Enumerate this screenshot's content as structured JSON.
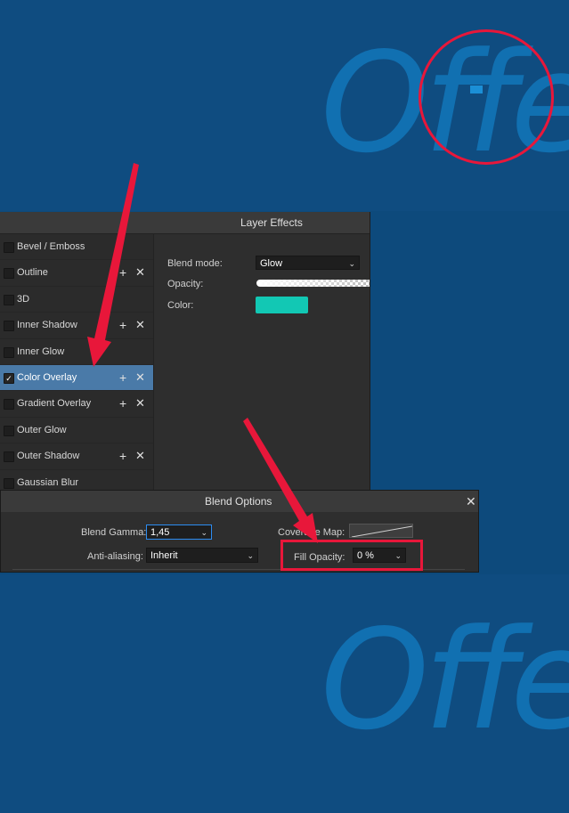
{
  "canvas": {
    "top_text": "Offe",
    "bottom_text": "Offe"
  },
  "layer_effects": {
    "title": "Layer Effects",
    "effects": [
      {
        "label": "Bevel / Emboss",
        "checked": false,
        "has_add": false,
        "selected": false
      },
      {
        "label": "Outline",
        "checked": false,
        "has_add": true,
        "selected": false
      },
      {
        "label": "3D",
        "checked": false,
        "has_add": false,
        "selected": false
      },
      {
        "label": "Inner Shadow",
        "checked": false,
        "has_add": true,
        "selected": false
      },
      {
        "label": "Inner Glow",
        "checked": false,
        "has_add": false,
        "selected": false
      },
      {
        "label": "Color Overlay",
        "checked": true,
        "has_add": true,
        "selected": true
      },
      {
        "label": "Gradient Overlay",
        "checked": false,
        "has_add": true,
        "selected": false
      },
      {
        "label": "Outer Glow",
        "checked": false,
        "has_add": false,
        "selected": false
      },
      {
        "label": "Outer Shadow",
        "checked": false,
        "has_add": true,
        "selected": false
      },
      {
        "label": "Gaussian Blur",
        "checked": false,
        "has_add": false,
        "selected": false
      }
    ],
    "add_symbol": "+",
    "remove_symbol": "✕",
    "properties": {
      "blend_mode_label": "Blend mode:",
      "blend_mode_value": "Glow",
      "opacity_label": "Opacity:",
      "color_label": "Color:",
      "color_value": "#12c8b4"
    }
  },
  "blend_options": {
    "title": "Blend Options",
    "close_symbol": "✕",
    "blend_gamma_label": "Blend Gamma:",
    "blend_gamma_value": "1,45",
    "coverage_map_label": "Coverage Map:",
    "anti_aliasing_label": "Anti-aliasing:",
    "anti_aliasing_value": "Inherit",
    "fill_opacity_label": "Fill Opacity:",
    "fill_opacity_value": "0 %"
  },
  "colors": {
    "canvas_blue": "#0f4c80",
    "text_blue": "#1170b1",
    "annotation_red": "#e8173a",
    "selected_row": "#4a7aa8",
    "panel_bg": "#2e2e2e"
  }
}
